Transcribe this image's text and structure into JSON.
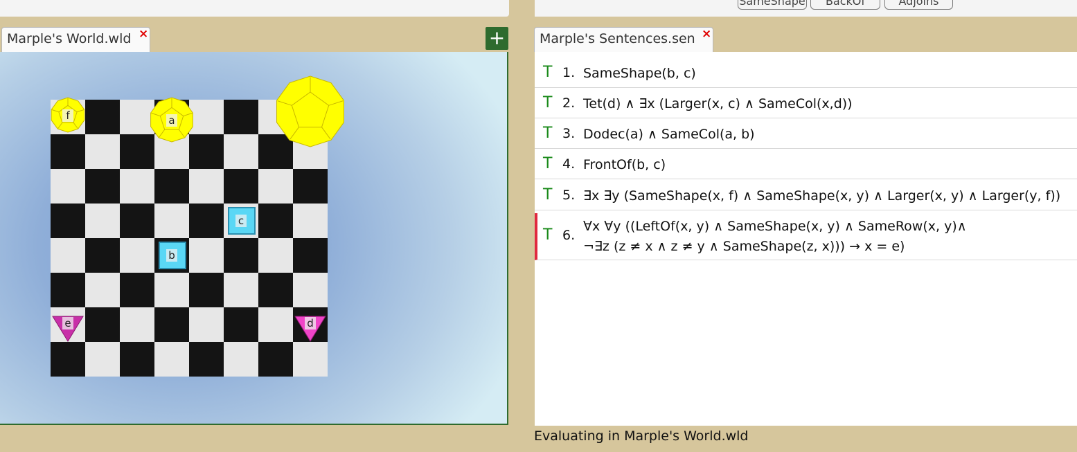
{
  "toolbar": {
    "buttons": [
      {
        "label": "SameShape"
      },
      {
        "label": "BackOf"
      },
      {
        "label": "Adjoins"
      }
    ]
  },
  "world_tab": {
    "label": "Marple's World.wld",
    "close": "×",
    "add": "+"
  },
  "sentences_tab": {
    "label": "Marple's Sentences.sen",
    "close": "×"
  },
  "objects": [
    {
      "name": "f",
      "shape": "dodec",
      "size": "small",
      "color": "#ffff00",
      "col": 0,
      "row": 0
    },
    {
      "name": "a",
      "shape": "dodec",
      "size": "medium",
      "color": "#ffff00",
      "col": 3,
      "row": 0
    },
    {
      "name": "",
      "shape": "dodec",
      "size": "large",
      "color": "#ffff00",
      "col": 7,
      "row": 0
    },
    {
      "name": "c",
      "shape": "cube",
      "size": "small",
      "color": "#5ad7f5",
      "col": 5,
      "row": 3
    },
    {
      "name": "b",
      "shape": "cube",
      "size": "small",
      "color": "#5ad7f5",
      "col": 3,
      "row": 4
    },
    {
      "name": "e",
      "shape": "tet",
      "size": "small",
      "color": "#c82fa8",
      "col": 0,
      "row": 6
    },
    {
      "name": "d",
      "shape": "tet",
      "size": "small",
      "color": "#f044c8",
      "col": 7,
      "row": 6
    }
  ],
  "sentences": [
    {
      "tv": "T",
      "num": "1.",
      "line1": "SameShape(b, c)",
      "line2": ""
    },
    {
      "tv": "T",
      "num": "2.",
      "line1": "Tet(d) ∧ ∃x (Larger(x, c) ∧ SameCol(x,d))",
      "line2": ""
    },
    {
      "tv": "T",
      "num": "3.",
      "line1": "Dodec(a) ∧ SameCol(a, b)",
      "line2": ""
    },
    {
      "tv": "T",
      "num": "4.",
      "line1": "FrontOf(b, c)",
      "line2": ""
    },
    {
      "tv": "T",
      "num": "5.",
      "line1": "∃x ∃y (SameShape(x, f) ∧ SameShape(x, y) ∧ Larger(x, y) ∧ Larger(y, f))",
      "line2": ""
    },
    {
      "tv": "T",
      "num": "6.",
      "line1": "∀x ∀y ((LeftOf(x, y) ∧ SameShape(x, y) ∧ SameRow(x, y)∧",
      "line2": "¬∃z (z ≠ x ∧ z ≠ y ∧ SameShape(z, x))) → x = e)"
    }
  ],
  "status": {
    "text": "Evaluating in Marple's World.wld"
  }
}
